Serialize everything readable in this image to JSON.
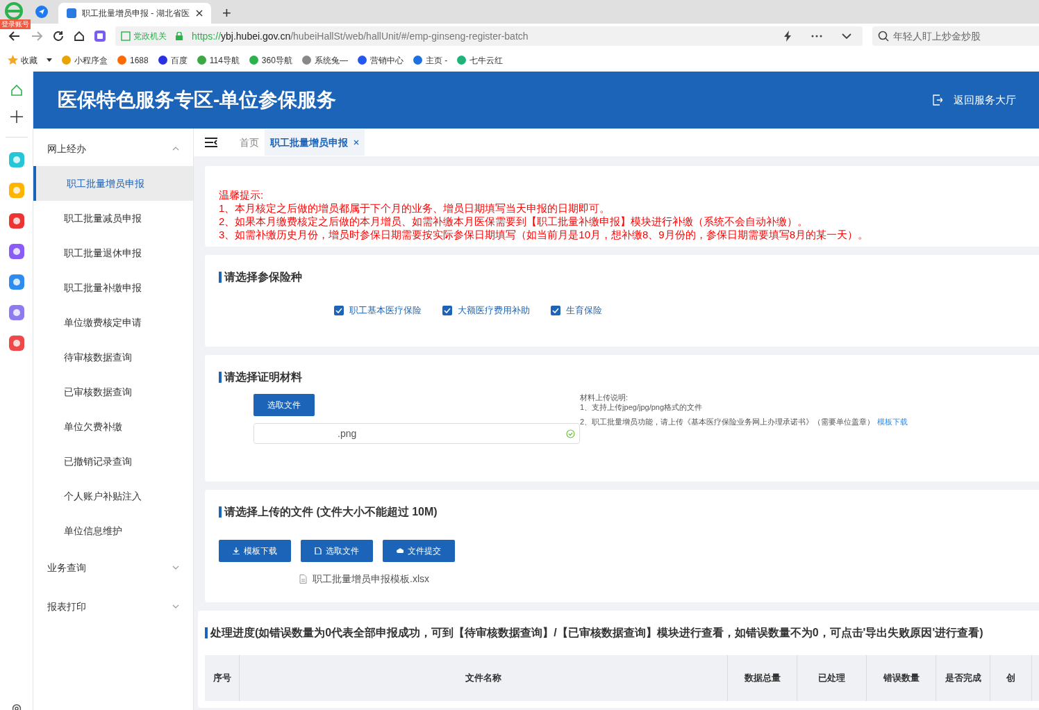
{
  "browser": {
    "profile_badge": "登录账号",
    "tabs": [
      {
        "title": "职工批量增员申报 - 湖北省医",
        "selected": true
      }
    ],
    "new_tab": "+",
    "security_label": "党政机关",
    "url_scheme": "https://",
    "url_host": "ybj.hubei.gov.cn",
    "url_path": "/hubeiHallSt/web/hallUnit/#/emp-ginseng-register-batch",
    "search_placeholder": "年轻人盯上炒金炒股",
    "bookmarks": [
      "收藏",
      "小程序盒",
      "1688",
      "百度",
      "114导航",
      "360导航",
      "系统兔—",
      "营销中心",
      "主页 -",
      "七牛云红"
    ]
  },
  "header": {
    "title": "医保特色服务专区-单位参保服务",
    "back_link": "返回服务大厅"
  },
  "sidebar": {
    "groups": [
      {
        "label": "网上经办",
        "expanded": true,
        "items": [
          {
            "label": "职工批量增员申报",
            "selected": true
          },
          {
            "label": "职工批量减员申报",
            "selected": false
          },
          {
            "label": "职工批量退休申报",
            "selected": false
          },
          {
            "label": "职工批量补缴申报",
            "selected": false
          },
          {
            "label": "单位缴费核定申请",
            "selected": false
          },
          {
            "label": "待审核数据查询",
            "selected": false
          },
          {
            "label": "已审核数据查询",
            "selected": false
          },
          {
            "label": "单位欠费补缴",
            "selected": false
          },
          {
            "label": "已撤销记录查询",
            "selected": false
          },
          {
            "label": "个人账户补贴注入",
            "selected": false
          },
          {
            "label": "单位信息维护",
            "selected": false
          }
        ]
      },
      {
        "label": "业务查询",
        "expanded": false
      },
      {
        "label": "报表打印",
        "expanded": false
      }
    ]
  },
  "page_tabs": [
    {
      "label": "首页",
      "selected": false,
      "closable": false
    },
    {
      "label": "职工批量增员申报",
      "selected": true,
      "closable": true
    }
  ],
  "notice": {
    "title": "温馨提示:",
    "lines": [
      "1、本月核定之后做的增员都属于下个月的业务、增员日期填写当天申报的日期即可。",
      "2、如果本月缴费核定之后做的本月增员、如需补缴本月医保需要到【职工批量补缴申报】模块进行补缴（系统不会自动补缴）。",
      "3、如需补缴历史月份，增员时参保日期需要按实际参保日期填写（如当前月是10月，想补缴8、9月份的，参保日期需要填写8月的某一天）。"
    ]
  },
  "insurance": {
    "title": "请选择参保险种",
    "options": [
      {
        "label": "职工基本医疗保险",
        "checked": true
      },
      {
        "label": "大额医疗费用补助",
        "checked": true
      },
      {
        "label": "生育保险",
        "checked": true
      }
    ]
  },
  "proof": {
    "title": "请选择证明材料",
    "button": "选取文件",
    "file": ".png",
    "uploaded": true,
    "notes_title": "材料上传说明:",
    "notes": [
      "1、支持上传jpeg/jpg/png格式的文件",
      "2、职工批量增员功能，请上传《基本医疗保险业务网上办理承诺书》（需要单位盖章）"
    ],
    "template_link": "模板下载"
  },
  "upload": {
    "title": "请选择上传的文件 (文件大小不能超过 10M)",
    "buttons": [
      {
        "kind": "download",
        "label": "模板下载"
      },
      {
        "kind": "file",
        "label": "选取文件"
      },
      {
        "kind": "upload",
        "label": "文件提交"
      }
    ],
    "file": "职工批量增员申报模板.xlsx"
  },
  "progress": {
    "title": "处理进度(如错误数量为0代表全部申报成功，可到【待审核数据查询】/【已审核数据查询】模块进行查看，如错误数量不为0，可点击'导出失败原因'进行查看)",
    "columns": [
      "序号",
      "文件名称",
      "数据总量",
      "已处理",
      "错误数量",
      "是否完成",
      "创"
    ]
  }
}
